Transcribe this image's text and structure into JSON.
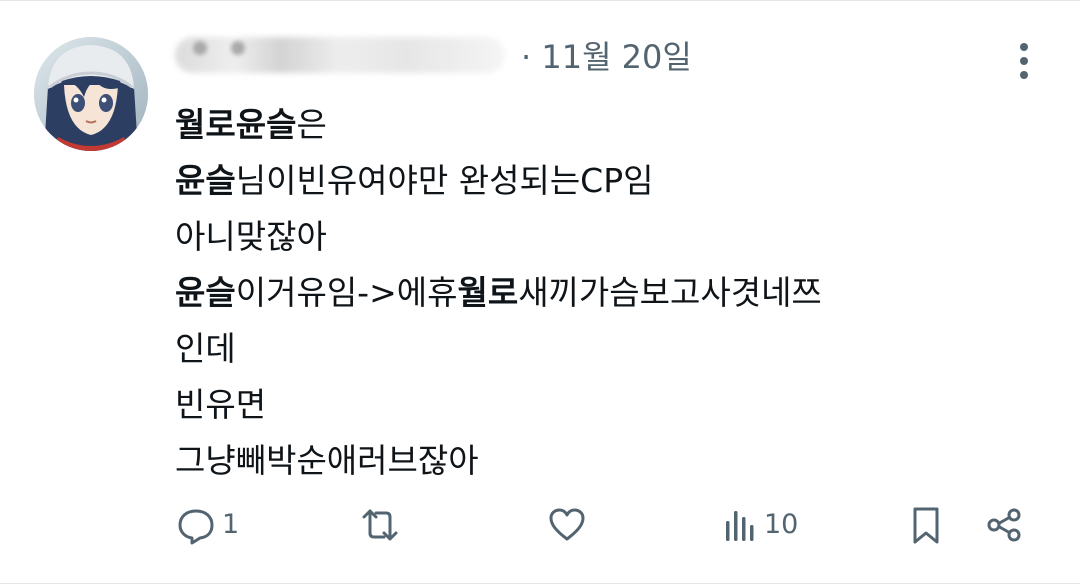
{
  "post": {
    "author_name": "",
    "date": "· 11월 20일",
    "lines": [
      {
        "bold": "월로윤슬",
        "rest": "은"
      },
      {
        "bold": "윤슬",
        "rest": "님이빈유여야만 완성되는CP임"
      },
      {
        "text": "아니맞잖아"
      },
      {
        "bold": "윤슬",
        "mid": "이거유임->에휴",
        "bold2": "월로",
        "rest": "새끼가슴보고사겻네쯔"
      },
      {
        "text": "인데"
      },
      {
        "text": "빈유면"
      },
      {
        "text": "그냥빼박순애러브잖아"
      }
    ]
  },
  "actions": {
    "reply_count": "1",
    "repost_count": "",
    "like_count": "",
    "views_count": "10"
  },
  "icons": {
    "reply": "speech-bubble-icon",
    "repost": "repost-arrows-icon",
    "like": "heart-icon",
    "views": "bar-chart-icon",
    "bookmark": "bookmark-icon",
    "share": "share-nodes-icon",
    "more": "vertical-dots-icon"
  },
  "colors": {
    "text": "#0f1419",
    "secondary": "#536471",
    "border": "#e1e6ea"
  }
}
